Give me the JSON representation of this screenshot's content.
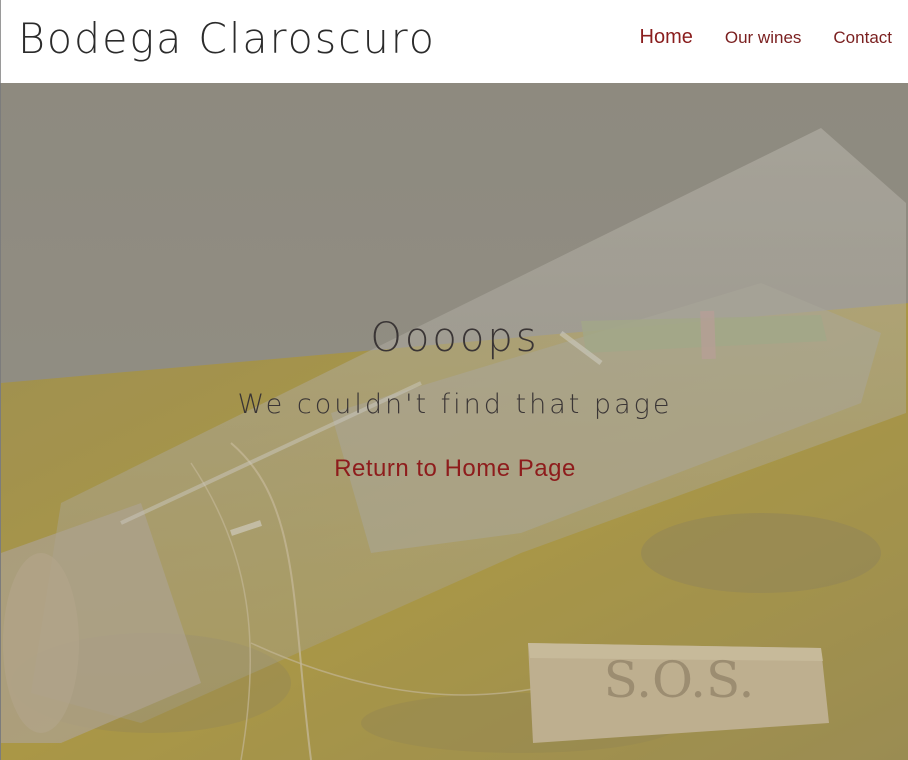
{
  "header": {
    "brand": "Bodega Claroscuro",
    "nav": [
      {
        "label": "Home"
      },
      {
        "label": "Our wines"
      },
      {
        "label": "Contact"
      }
    ]
  },
  "error": {
    "title": "Oooops",
    "subtitle": "We couldn't find that page",
    "link_label": "Return to Home Page"
  },
  "background": {
    "tag_text": "S.O.S."
  },
  "colors": {
    "accent": "#8e1c1c",
    "text_dark": "#3a3535",
    "header_bg": "#ffffff",
    "table_yellow": "#b89c25",
    "wall_grey": "#8f8c82"
  }
}
